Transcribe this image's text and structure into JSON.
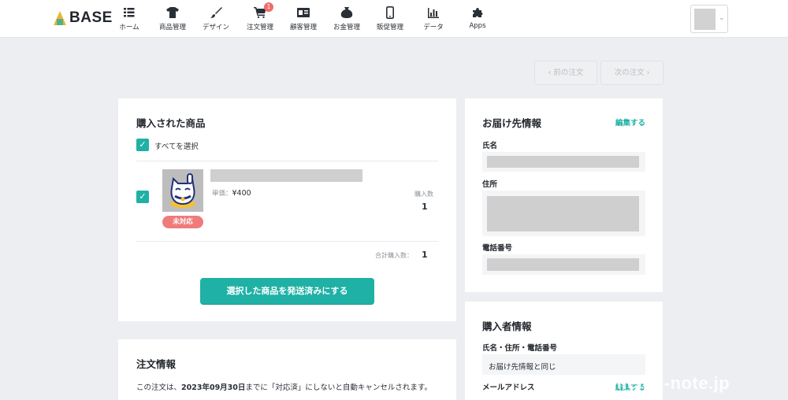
{
  "app": {
    "logo_text": "BASE"
  },
  "nav": [
    {
      "label": "ホーム",
      "icon": "list-icon"
    },
    {
      "label": "商品管理",
      "icon": "tshirt-icon"
    },
    {
      "label": "デザイン",
      "icon": "paintbrush-icon"
    },
    {
      "label": "注文管理",
      "icon": "cart-icon",
      "badge": "1"
    },
    {
      "label": "顧客管理",
      "icon": "id-card-icon"
    },
    {
      "label": "お金管理",
      "icon": "money-bag-icon"
    },
    {
      "label": "販促管理",
      "icon": "smartphone-icon"
    },
    {
      "label": "データ",
      "icon": "bar-chart-icon"
    },
    {
      "label": "Apps",
      "icon": "puzzle-icon"
    }
  ],
  "pager": {
    "prev": "前の注文",
    "next": "次の注文"
  },
  "products": {
    "title": "購入された商品",
    "select_all": "すべてを選択",
    "item": {
      "unit_price_label": "単価：",
      "unit_price": "¥400",
      "qty_label": "購入数",
      "qty": "1",
      "status": "未対応"
    },
    "total_label": "合計購入数：",
    "total": "1",
    "ship_button": "選択した商品を発送済みにする"
  },
  "delivery": {
    "title": "お届け先情報",
    "edit": "編集する",
    "name_label": "氏名",
    "address_label": "住所",
    "phone_label": "電話番号"
  },
  "buyer": {
    "title": "購入者情報",
    "combined_label": "氏名・住所・電話番号",
    "combined_value": "お届け先情報と同じ",
    "email_label": "メールアドレス",
    "edit": "編集する"
  },
  "order_info": {
    "title": "注文情報",
    "notice_prefix": "この注文は、",
    "notice_date": "2023年09月30日",
    "notice_suffix": "までに「対応済」にしないと自動キャンセルされます。"
  },
  "watermark": "memo-note.jp",
  "colors": {
    "accent": "#1fb1a5",
    "status_red": "#ef7b7b",
    "badge": "#ef6c6c"
  }
}
